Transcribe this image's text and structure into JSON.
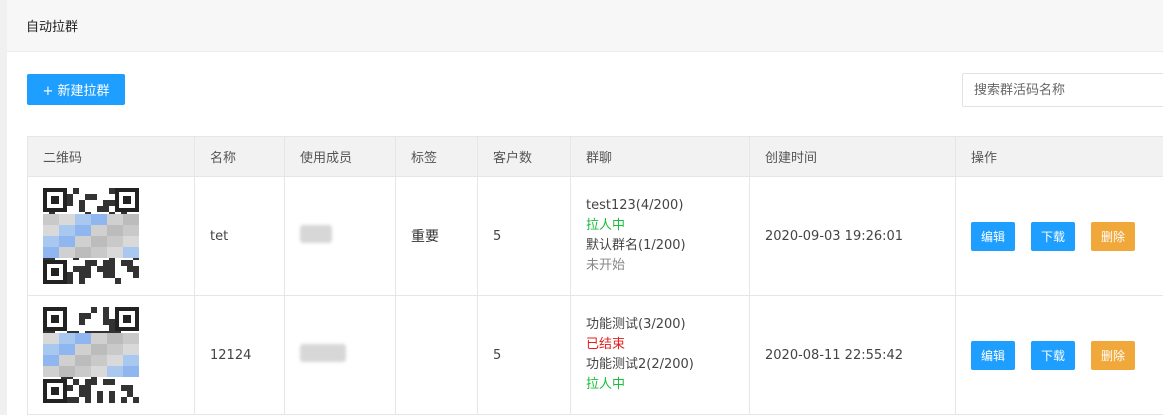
{
  "header": {
    "title": "自动拉群"
  },
  "toolbar": {
    "new_button": "+ 新建拉群",
    "search_placeholder": "搜索群活码名称"
  },
  "table": {
    "columns": [
      "二维码",
      "名称",
      "使用成员",
      "标签",
      "客户数",
      "群聊",
      "创建时间",
      "操作"
    ],
    "rows": [
      {
        "name": "tet",
        "member": "",
        "tag": "重要",
        "customers": "5",
        "groups": [
          {
            "name": "test123(4/200)",
            "status": "拉人中",
            "status_color": "#19be3b"
          },
          {
            "name": "默认群名(1/200)",
            "status": "未开始",
            "status_color": "#888888"
          }
        ],
        "created": "2020-09-03 19:26:01",
        "actions": [
          "编辑",
          "下载",
          "删除"
        ]
      },
      {
        "name": "12124",
        "member": "",
        "tag": "",
        "customers": "5",
        "groups": [
          {
            "name": "功能测试(3/200)",
            "status": "已结束",
            "status_color": "#e0201f"
          },
          {
            "name": "功能测试2(2/200)",
            "status": "拉人中",
            "status_color": "#19be3b"
          }
        ],
        "created": "2020-08-11 22:55:42",
        "actions": [
          "编辑",
          "下载",
          "删除"
        ]
      }
    ]
  },
  "colors": {
    "primary": "#1e9fff",
    "danger": "#f0a83a"
  }
}
